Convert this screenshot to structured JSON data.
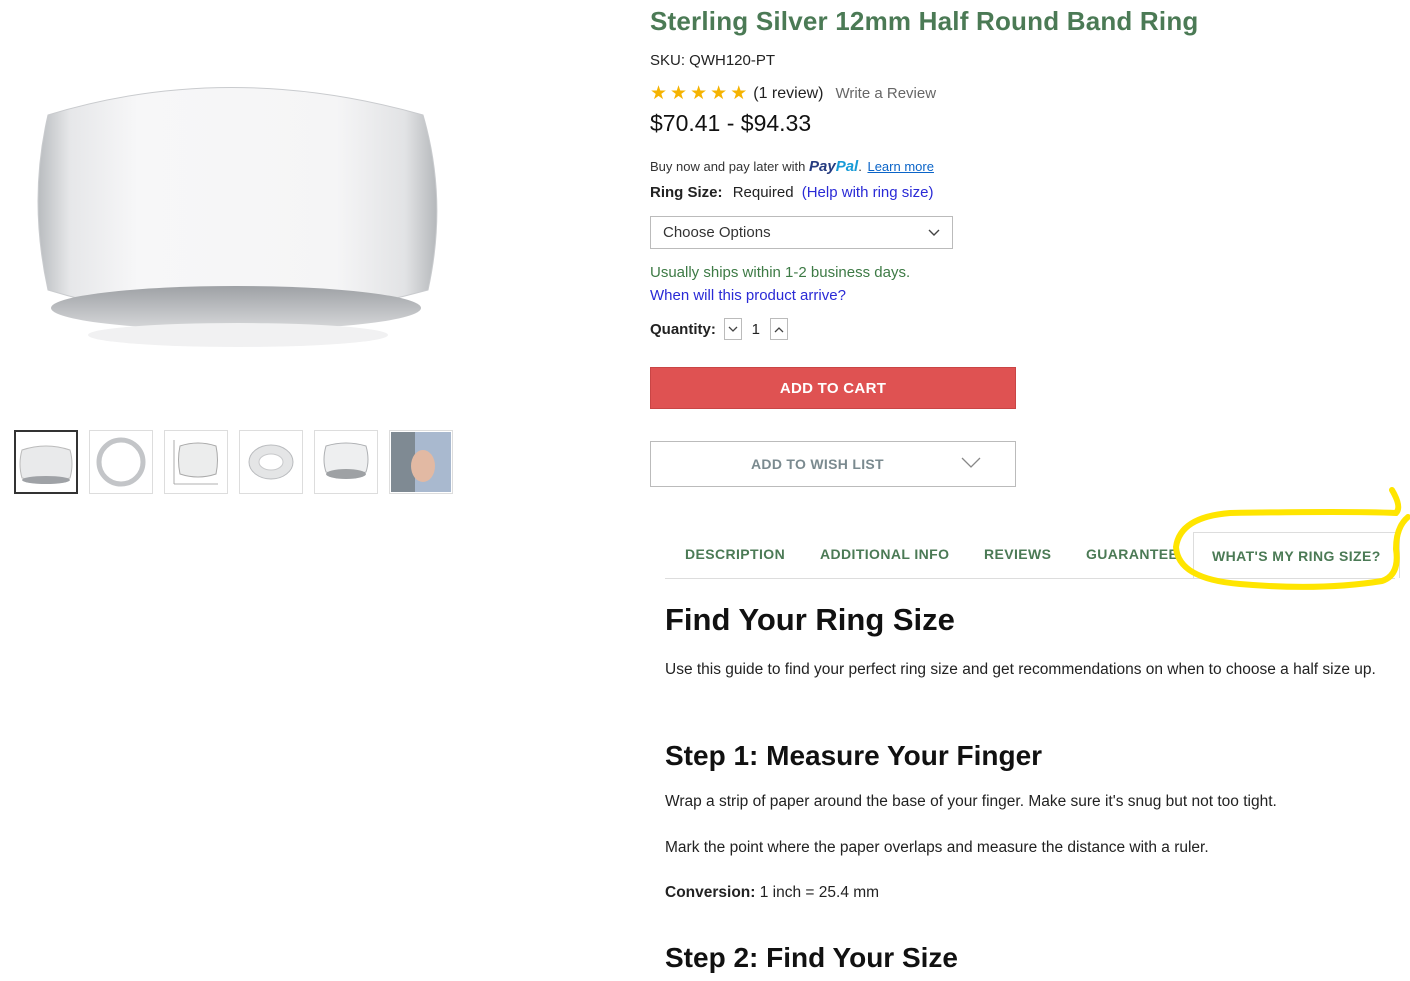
{
  "product": {
    "title": "Sterling Silver 12mm Half Round Band Ring",
    "sku": "SKU: QWH120-PT",
    "rating_stars": 5,
    "review_count": "(1 review)",
    "write_review": "Write a Review",
    "price": "$70.41 - $94.33"
  },
  "paypal": {
    "prefix": "Buy now and pay later with",
    "logo_pay": "Pay",
    "logo_pal": "Pal",
    "suffix": ".",
    "learn_more": "Learn more"
  },
  "ring_size": {
    "label": "Ring Size:",
    "required": "Required",
    "help": "(Help with ring size)",
    "select_value": "Choose Options"
  },
  "shipping": {
    "ships": "Usually ships within 1-2 business days.",
    "arrive": "When will this product arrive?"
  },
  "quantity": {
    "label": "Quantity:",
    "value": "1"
  },
  "buttons": {
    "add_to_cart": "ADD TO CART",
    "add_to_wish_list": "ADD TO WISH LIST"
  },
  "tabs": [
    {
      "label": "DESCRIPTION"
    },
    {
      "label": "ADDITIONAL INFO"
    },
    {
      "label": "REVIEWS"
    },
    {
      "label": "GUARANTEE"
    },
    {
      "label": "WHAT'S MY RING SIZE?"
    }
  ],
  "content": {
    "heading": "Find Your Ring Size",
    "intro": "Use this guide to find your perfect ring size and get recommendations on when to choose a half size up.",
    "step1_heading": "Step 1: Measure Your Finger",
    "step1_p1": "Wrap a strip of paper around the base of your finger. Make sure it's snug but not too tight.",
    "step1_p2": "Mark the point where the paper overlaps and measure the distance with a ruler.",
    "conversion_label": "Conversion:",
    "conversion_value": " 1 inch = 25.4 mm",
    "step2_heading": "Step 2: Find Your Size"
  },
  "colors": {
    "brand_green": "#4b7a55",
    "cart_red": "#df5252",
    "star": "#f5b301",
    "link_blue": "#2a2ad6",
    "highlight": "#ffe500"
  }
}
